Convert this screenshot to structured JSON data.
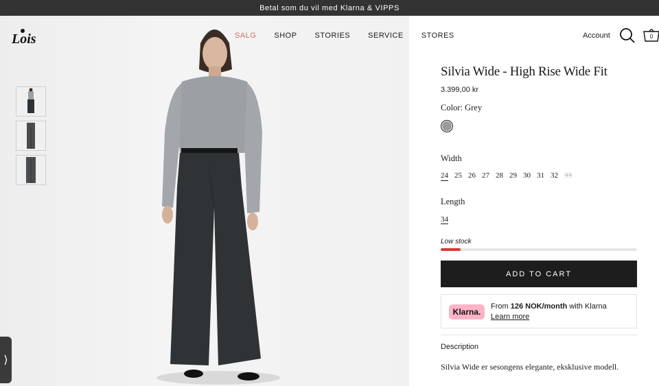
{
  "announcement": "Betal som du vil med Klarna & VIPPS",
  "logo": {
    "text": "Lois"
  },
  "nav": {
    "items": [
      "SALG",
      "SHOP",
      "STORIES",
      "SERVICE",
      "STORES"
    ],
    "account": "Account",
    "cart_count": "0"
  },
  "product": {
    "title": "Silvia Wide - High Rise Wide Fit",
    "price": "3.399,00 kr",
    "color_label": "Color:",
    "color_value": "Grey",
    "width_label": "Width",
    "widths": [
      "24",
      "25",
      "26",
      "27",
      "28",
      "29",
      "30",
      "31",
      "32",
      "33"
    ],
    "width_selected": "24",
    "width_unavailable": "33",
    "length_label": "Length",
    "length_value": "34",
    "stock_label": "Low stock",
    "stock_level": 0.1,
    "add_to_cart": "ADD TO CART",
    "klarna": {
      "badge": "Klarna.",
      "from": "From",
      "amount": "126 NOK/month",
      "with": "with Klarna",
      "learn_more": "Learn more"
    },
    "description_label": "Description",
    "description_text": "Silvia Wide er sesongens elegante, eksklusive modell."
  },
  "colors": {
    "accent_red": "#e0343a",
    "sale_pink": "#d26a6a",
    "klarna_pink": "#ffb3c7",
    "button_dark": "#1d1d1d"
  }
}
